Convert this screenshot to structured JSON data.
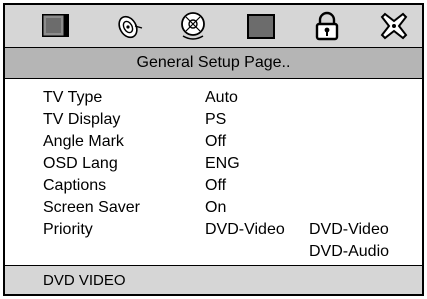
{
  "toolbar": {
    "icons": [
      "tv-icon",
      "speaker-icon",
      "disc-icon",
      "screen-icon",
      "lock-icon",
      "exit-icon"
    ]
  },
  "page": {
    "title": "General Setup Page.."
  },
  "settings": [
    {
      "label": "TV Type",
      "value": "Auto"
    },
    {
      "label": "TV Display",
      "value": "PS"
    },
    {
      "label": "Angle Mark",
      "value": "Off"
    },
    {
      "label": "OSD Lang",
      "value": "ENG"
    },
    {
      "label": "Captions",
      "value": "Off"
    },
    {
      "label": "Screen Saver",
      "value": "On"
    },
    {
      "label": "Priority",
      "value": "DVD-Video",
      "options": [
        "DVD-Video",
        "DVD-Audio"
      ]
    }
  ],
  "footer": {
    "status": "DVD VIDEO"
  }
}
